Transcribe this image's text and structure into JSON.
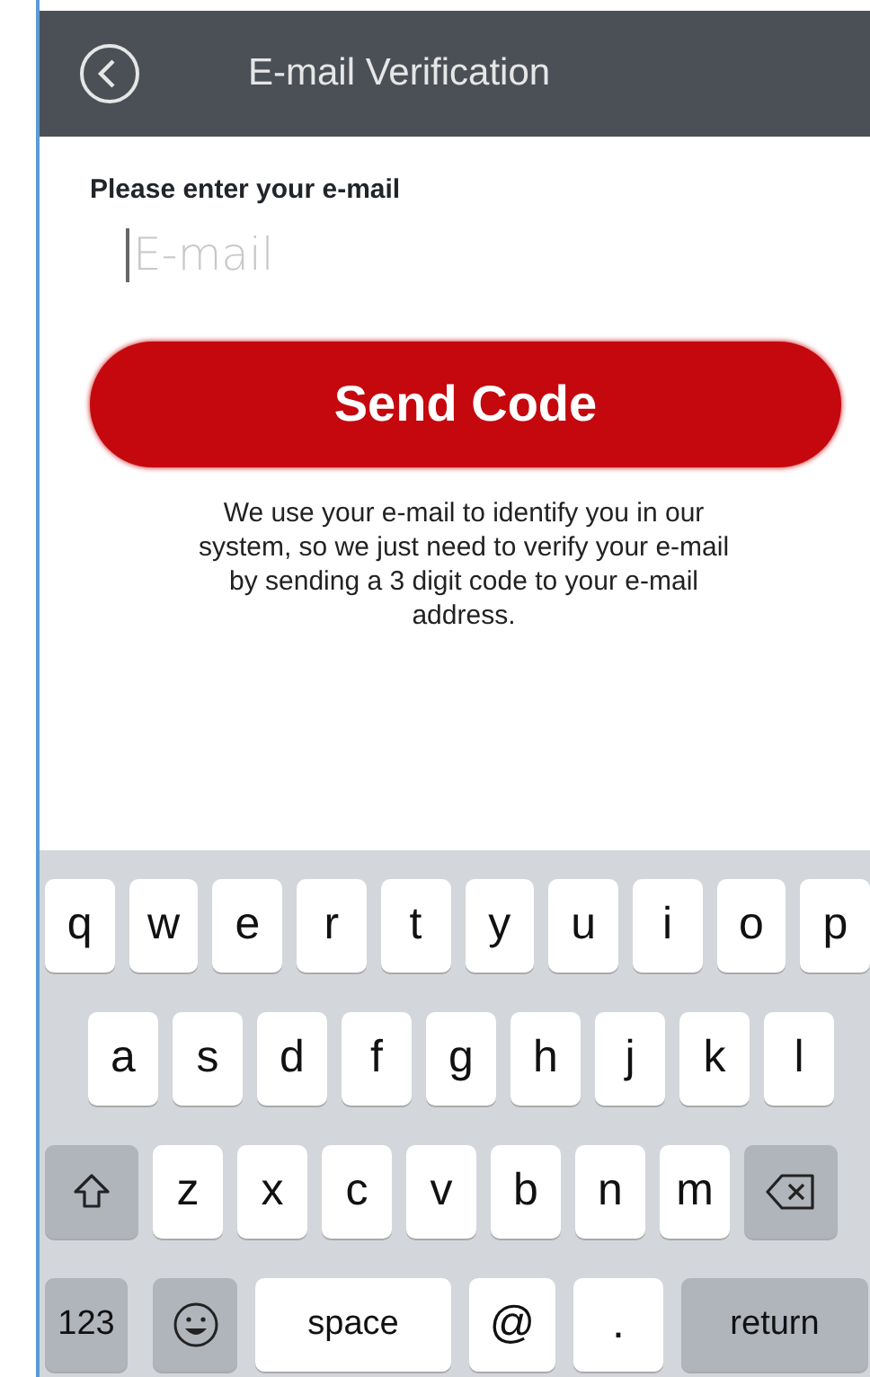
{
  "header": {
    "title": "E-mail Verification"
  },
  "form": {
    "label": "Please enter your e-mail",
    "email": {
      "placeholder": "E-mail",
      "focused": true
    },
    "button": "Send Code",
    "note": "We use your e-mail to identify you in our system, so we just need to verify your e-mail by sending a 3 digit code to your e-mail address."
  },
  "keyboard": {
    "rows": [
      {
        "keys": [
          {
            "kind": "letter",
            "label": "q"
          },
          {
            "kind": "letter",
            "label": "w"
          },
          {
            "kind": "letter",
            "label": "e"
          },
          {
            "kind": "letter",
            "label": "r"
          },
          {
            "kind": "letter",
            "label": "t"
          },
          {
            "kind": "letter",
            "label": "y"
          },
          {
            "kind": "letter",
            "label": "u"
          },
          {
            "kind": "letter",
            "label": "i"
          },
          {
            "kind": "letter",
            "label": "o"
          },
          {
            "kind": "letter",
            "label": "p"
          }
        ]
      },
      {
        "keys": [
          {
            "kind": "letter",
            "label": "a"
          },
          {
            "kind": "letter",
            "label": "s"
          },
          {
            "kind": "letter",
            "label": "d"
          },
          {
            "kind": "letter",
            "label": "f"
          },
          {
            "kind": "letter",
            "label": "g"
          },
          {
            "kind": "letter",
            "label": "h"
          },
          {
            "kind": "letter",
            "label": "j"
          },
          {
            "kind": "letter",
            "label": "k"
          },
          {
            "kind": "letter",
            "label": "l"
          }
        ]
      },
      {
        "keys": [
          {
            "kind": "shift"
          },
          {
            "kind": "letter",
            "label": "z"
          },
          {
            "kind": "letter",
            "label": "x"
          },
          {
            "kind": "letter",
            "label": "c"
          },
          {
            "kind": "letter",
            "label": "v"
          },
          {
            "kind": "letter",
            "label": "b"
          },
          {
            "kind": "letter",
            "label": "n"
          },
          {
            "kind": "letter",
            "label": "m"
          },
          {
            "kind": "delete"
          }
        ]
      },
      {
        "keys": [
          {
            "kind": "function",
            "label": "123"
          },
          {
            "kind": "emoji"
          },
          {
            "kind": "space",
            "label": "space"
          },
          {
            "kind": "letter",
            "label": "@"
          },
          {
            "kind": "letter",
            "label": "."
          },
          {
            "kind": "function",
            "label": "return"
          }
        ]
      }
    ]
  }
}
